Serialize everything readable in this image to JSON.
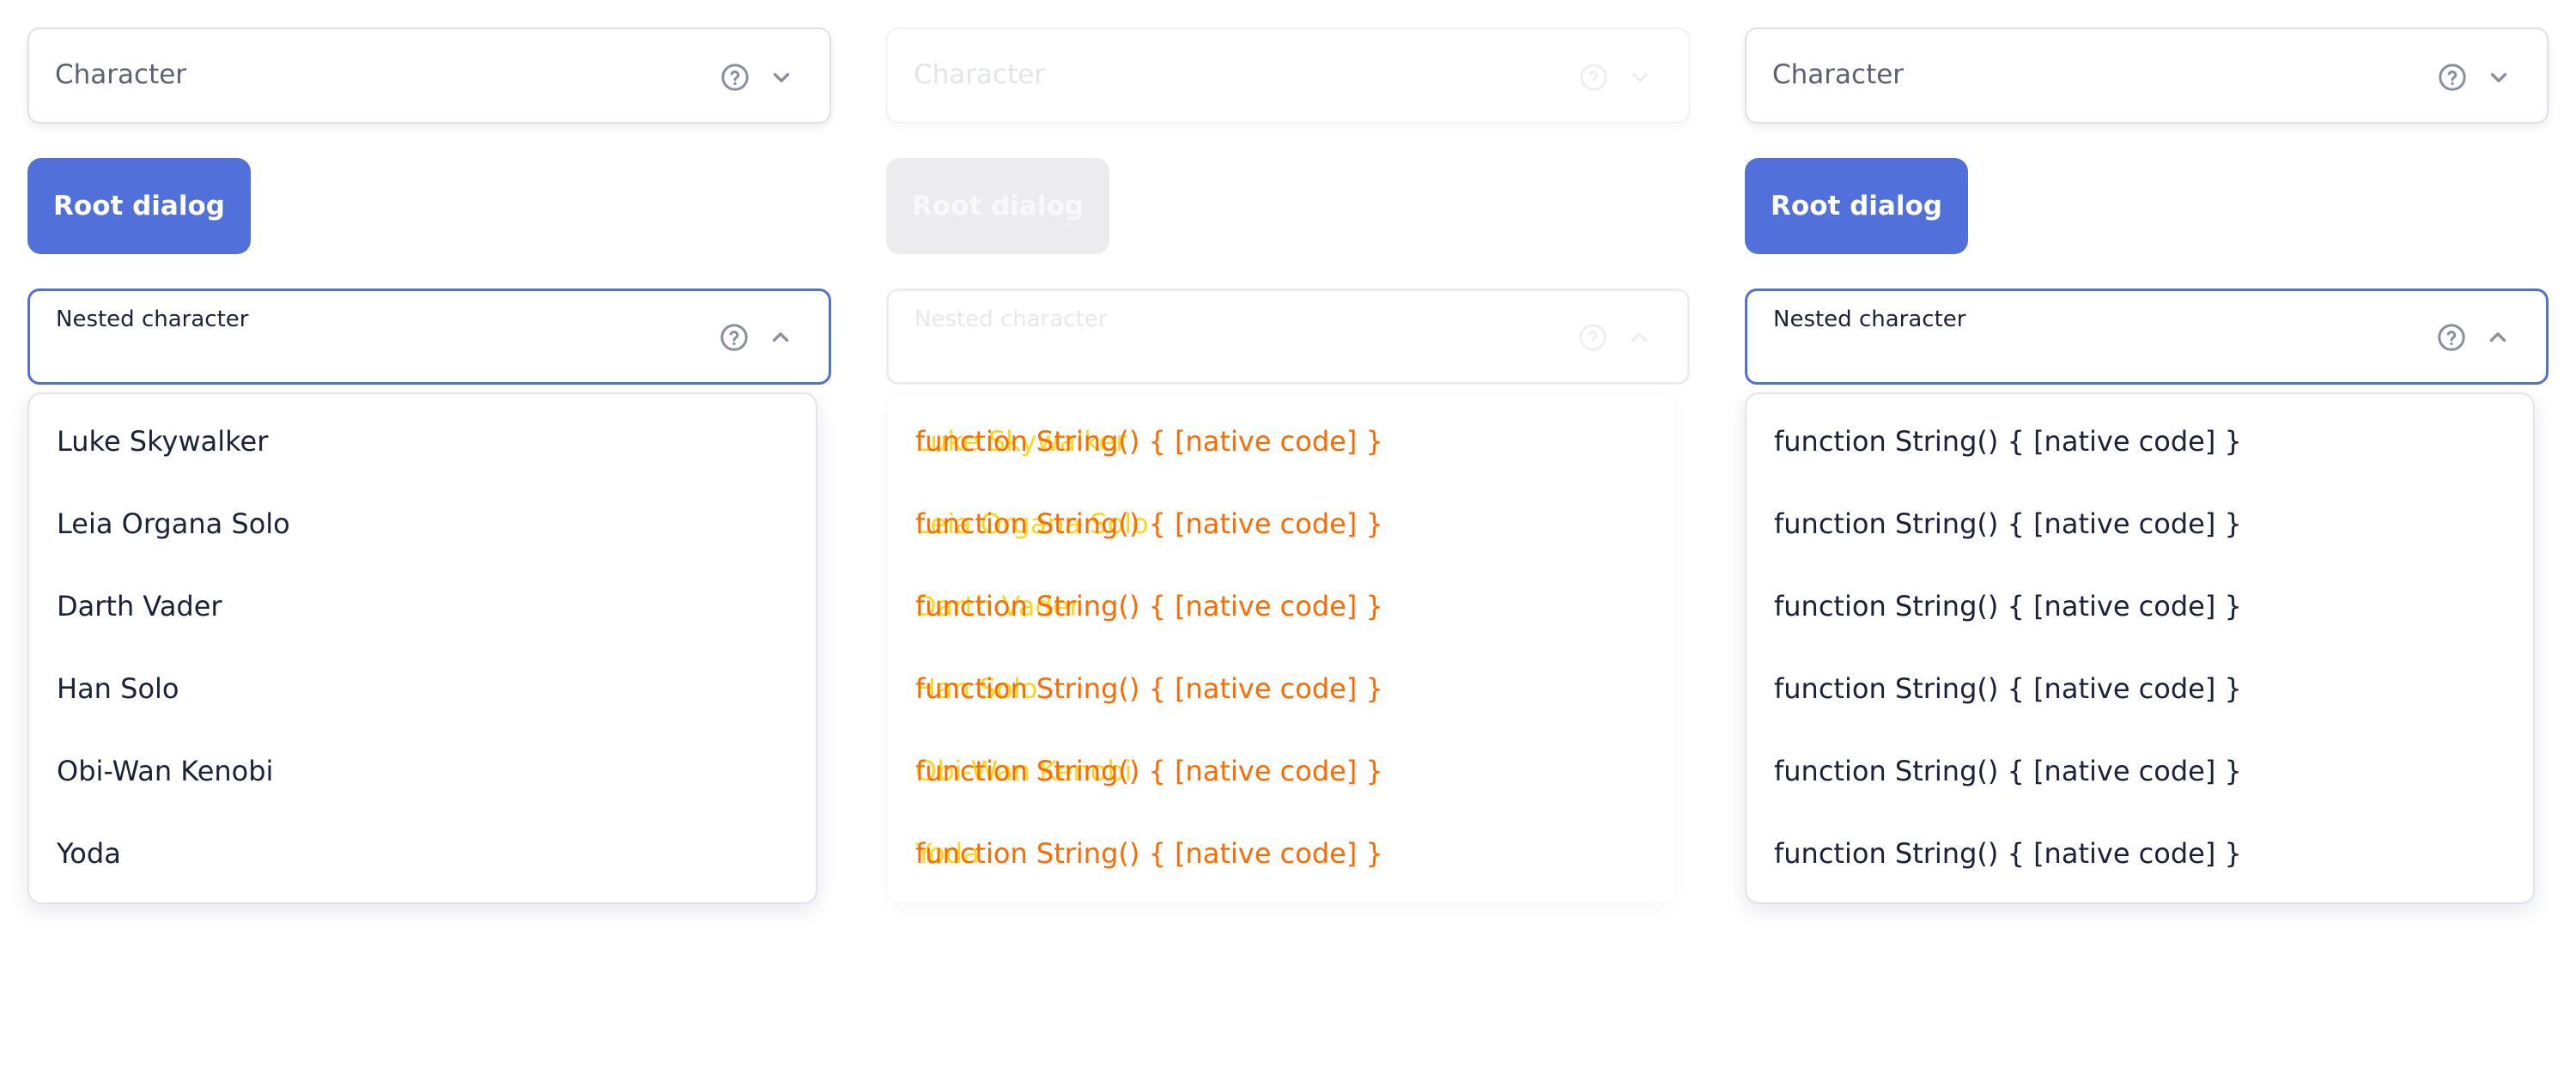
{
  "columns": [
    {
      "select_label": "Character",
      "button_label": "Root dialog",
      "nested_label": "Nested character",
      "options": [
        "Luke Skywalker",
        "Leia Organa Solo",
        "Darth Vader",
        "Han Solo",
        "Obi-Wan Kenobi",
        "Yoda"
      ]
    },
    {
      "select_label": "Character",
      "button_label": "Root dialog",
      "nested_label": "Nested character",
      "options": [
        "function String() { [native code] }",
        "function String() { [native code] }",
        "function String() { [native code] }",
        "function String() { [native code] }",
        "function String() { [native code] }",
        "function String() { [native code] }"
      ],
      "ghost_options": [
        "Luke Skywalker",
        "Leia Organa Solo",
        "Darth Vader",
        "Han Solo",
        "Obi-Wan Kenobi",
        "Yoda"
      ]
    },
    {
      "select_label": "Character",
      "button_label": "Root dialog",
      "nested_label": "Nested character",
      "options": [
        "function String() { [native code] }",
        "function String() { [native code] }",
        "function String() { [native code] }",
        "function String() { [native code] }",
        "function String() { [native code] }",
        "function String() { [native code] }"
      ]
    }
  ],
  "icons": {
    "help": "question-circle-icon",
    "chevron_down": "chevron-down-icon",
    "chevron_up": "chevron-up-icon"
  },
  "colors": {
    "accent": "#5170d9",
    "text": "#1b2237",
    "muted": "#5c6171",
    "diff_added": "#ff6a00",
    "diff_removed": "#f7d200"
  }
}
